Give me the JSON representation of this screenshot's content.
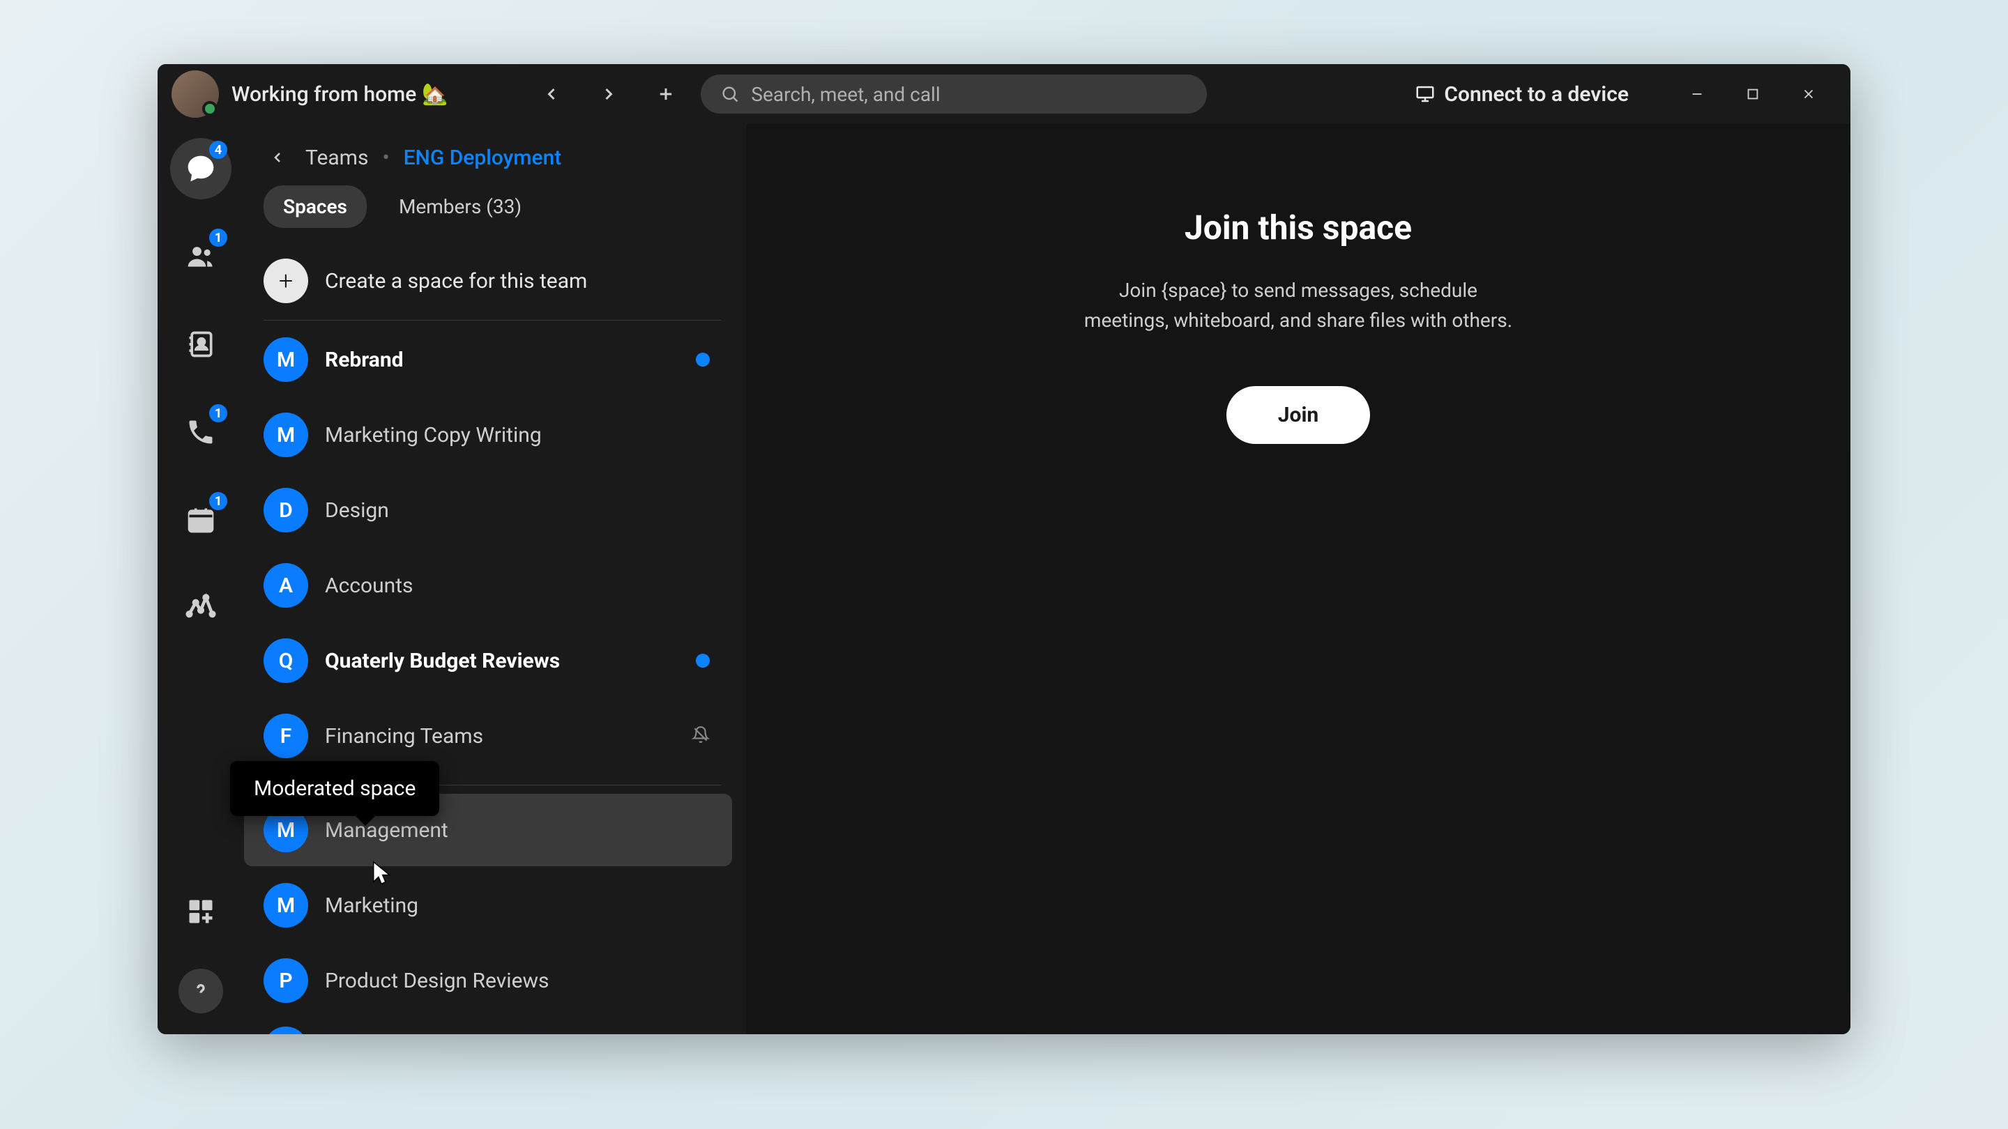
{
  "titlebar": {
    "status": "Working from home",
    "status_emoji": "🏡",
    "search_placeholder": "Search, meet, and call",
    "connect_label": "Connect to a device"
  },
  "rail": {
    "chat_badge": "4",
    "people_badge": "1",
    "calls_badge": "1",
    "calendar_badge": "1"
  },
  "sidebar": {
    "crumb_root": "Teams",
    "crumb_current": "ENG Deployment",
    "tab_spaces": "Spaces",
    "tab_members": "Members (33)",
    "create_label": "Create a space for this team",
    "tooltip": "Moderated space",
    "spaces": [
      {
        "initial": "M",
        "name": "Rebrand",
        "bold": true,
        "unread": true
      },
      {
        "initial": "M",
        "name": "Marketing Copy Writing"
      },
      {
        "initial": "D",
        "name": "Design"
      },
      {
        "initial": "A",
        "name": "Accounts"
      },
      {
        "initial": "Q",
        "name": "Quaterly Budget Reviews",
        "bold": true,
        "unread": true
      },
      {
        "initial": "F",
        "name": "Financing Teams",
        "muted": true
      },
      {
        "initial": "M",
        "name": "Management",
        "hovered": true
      },
      {
        "initial": "M",
        "name": "Marketing"
      },
      {
        "initial": "P",
        "name": "Product Design Reviews"
      }
    ]
  },
  "main": {
    "title": "Join this space",
    "description": "Join {space} to send messages, schedule meetings, whiteboard, and share files with others.",
    "join_label": "Join"
  }
}
